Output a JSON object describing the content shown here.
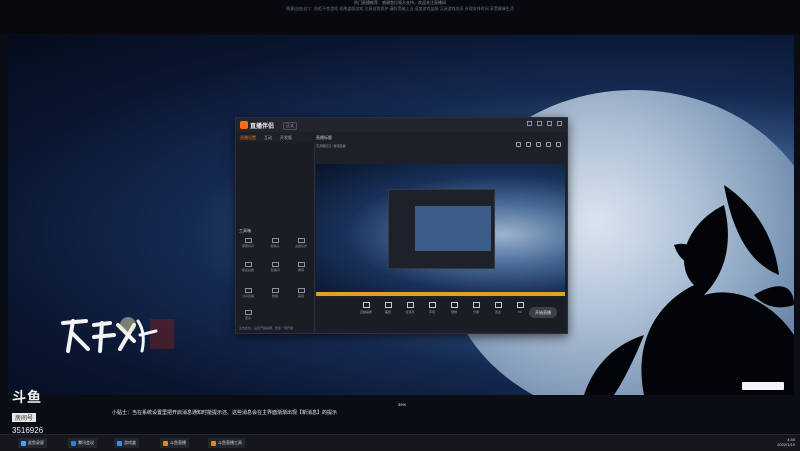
{
  "top_notice": {
    "line1": "热门直播推荐：感谢各位观众支持，欢迎关注直播间",
    "line2": "随意自由出口：抗拒不良游戏 拒绝盗版游戏 注意自我保护 谨防受骗上当 适度游戏益脑 沉迷游戏伤身 合理安排时间 享受健康生活"
  },
  "obs_window": {
    "app_name": "直播伴侣",
    "version_badge": "正式",
    "tabs": [
      "直播设置",
      "互动",
      "开发版"
    ],
    "main_title": "直播标题",
    "sub_text": "天涯明月刀 / 游戏直播",
    "sidebar_header": "工具箱",
    "tools": [
      "屏幕共享",
      "摄像头",
      "主播任务",
      "粉丝勋章",
      "直播间",
      "弹幕",
      "分享直播",
      "数据",
      "美颜",
      "更多"
    ],
    "sidebar_hint": "点击此处，设置开播提醒，更多一键开播",
    "bottom_buttons": [
      "直播画质",
      "美颜",
      "麦克风",
      "声音",
      "录制",
      "分屏",
      "连麦",
      "PK"
    ],
    "live_button": "开始直播"
  },
  "stream_overlay": {
    "platform_brand": "斗鱼",
    "room_label": "房间号",
    "room_number": "3516926",
    "banner_text": "小贴士：当在系统设置里把开启消息通知时能提示还、这些消息会在主界面渐渐出现【新消息】的提示",
    "percent": "39%"
  },
  "taskbar": {
    "items": [
      {
        "label": "鲨鱼录屏",
        "color": "#4aa3ff"
      },
      {
        "label": "腾讯会议",
        "color": "#2f7bf2"
      },
      {
        "label": "游戏盒",
        "color": "#3d8bff"
      },
      {
        "label": "斗鱼直播",
        "color": "#ff7a1a"
      },
      {
        "label": "斗鱼直播工具",
        "color": "#ff7a1a"
      }
    ],
    "time": "4:50",
    "date": "2022/1/19"
  }
}
